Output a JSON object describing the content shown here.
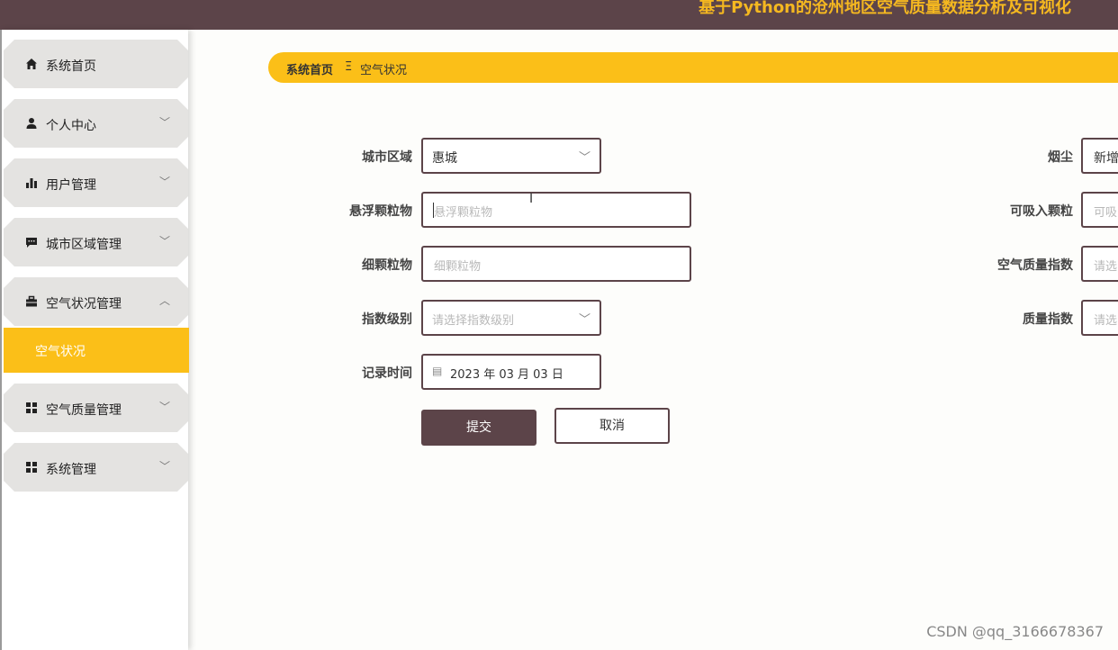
{
  "header": {
    "title": "基于Python的沧州地区空气质量数据分析及可视化"
  },
  "sidebar": {
    "items": [
      {
        "label": "系统首页",
        "icon": "home-icon"
      },
      {
        "label": "个人中心",
        "icon": "person-icon"
      },
      {
        "label": "用户管理",
        "icon": "bar-chart-icon"
      },
      {
        "label": "城市区域管理",
        "icon": "message-icon"
      },
      {
        "label": "空气状况管理",
        "icon": "briefcase-icon",
        "expanded": true
      },
      {
        "label": "空气质量管理",
        "icon": "grid-icon"
      },
      {
        "label": "系统管理",
        "icon": "grid-icon"
      }
    ],
    "active_sub": "空气状况"
  },
  "breadcrumb": {
    "home": "系统首页",
    "separator": "Ξ",
    "current": "空气状况"
  },
  "form": {
    "city_area": {
      "label": "城市区域",
      "value": "惠城"
    },
    "suspended_particles": {
      "label": "悬浮颗粒物",
      "placeholder": "悬浮颗粒物"
    },
    "fine_particles": {
      "label": "细颗粒物",
      "placeholder": "细颗粒物"
    },
    "index_level": {
      "label": "指数级别",
      "placeholder": "请选择指数级别"
    },
    "record_time": {
      "label": "记录时间",
      "value": "2023 年 03 月 03 日"
    },
    "smoke_dust": {
      "label": "烟尘",
      "value": "新增"
    },
    "inhalable_particles": {
      "label": "可吸入颗粒",
      "placeholder": "可吸"
    },
    "aqi": {
      "label": "空气质量指数",
      "placeholder": "请选"
    },
    "quality_index": {
      "label": "质量指数",
      "placeholder": "请选"
    }
  },
  "buttons": {
    "submit": "提交",
    "cancel": "取消"
  },
  "watermark": "CSDN @qq_3166678367",
  "colors": {
    "primary": "#5c4449",
    "accent": "#fbbf18",
    "menu_bg": "#e4e3e1"
  }
}
